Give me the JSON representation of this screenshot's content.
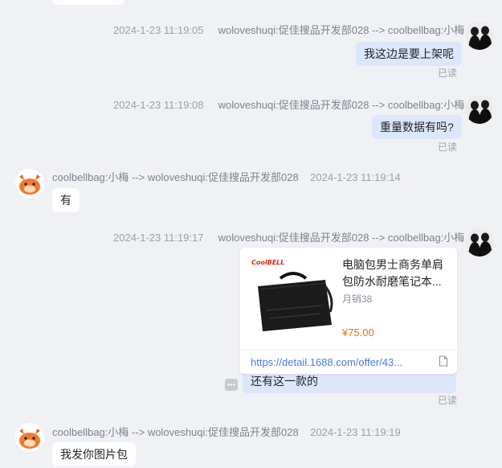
{
  "messages": [
    {
      "meta_time": "2024-1-23 11:19:05",
      "meta_who": "woloveshuqi:促佳搜品开发部028 --> coolbellbag:小梅",
      "text": "我这边是要上架呢",
      "status": "已读"
    },
    {
      "meta_time": "2024-1-23 11:19:08",
      "meta_who": "woloveshuqi:促佳搜品开发部028 --> coolbellbag:小梅",
      "text": "重量数据有吗?",
      "status": "已读"
    },
    {
      "meta_who": "coolbellbag:小梅 --> woloveshuqi:促佳搜品开发部028",
      "meta_time": "2024-1-23 11:19:14",
      "text": "有"
    },
    {
      "meta_time": "2024-1-23 11:19:17",
      "meta_who": "woloveshuqi:促佳搜品开发部028 --> coolbellbag:小梅",
      "text": "还有这一款的",
      "status": "已读",
      "card": {
        "brand": "CoolBELL",
        "title": "电脑包男士商务单肩包防水耐磨笔记本...",
        "sales": "月销38",
        "price": "¥75.00",
        "link": "https://detail.1688.com/offer/43..."
      }
    },
    {
      "meta_who": "coolbellbag:小梅 --> woloveshuqi:促佳搜品开发部028",
      "meta_time": "2024-1-23 11:19:19",
      "text": "我发你图片包"
    }
  ],
  "icons": {
    "doc": "document-icon",
    "more": "more-icon"
  },
  "colors": {
    "outgoing_bubble": "#dde7fb",
    "incoming_bubble": "#ffffff",
    "link": "#4a7bd8",
    "price": "#f06a12"
  }
}
